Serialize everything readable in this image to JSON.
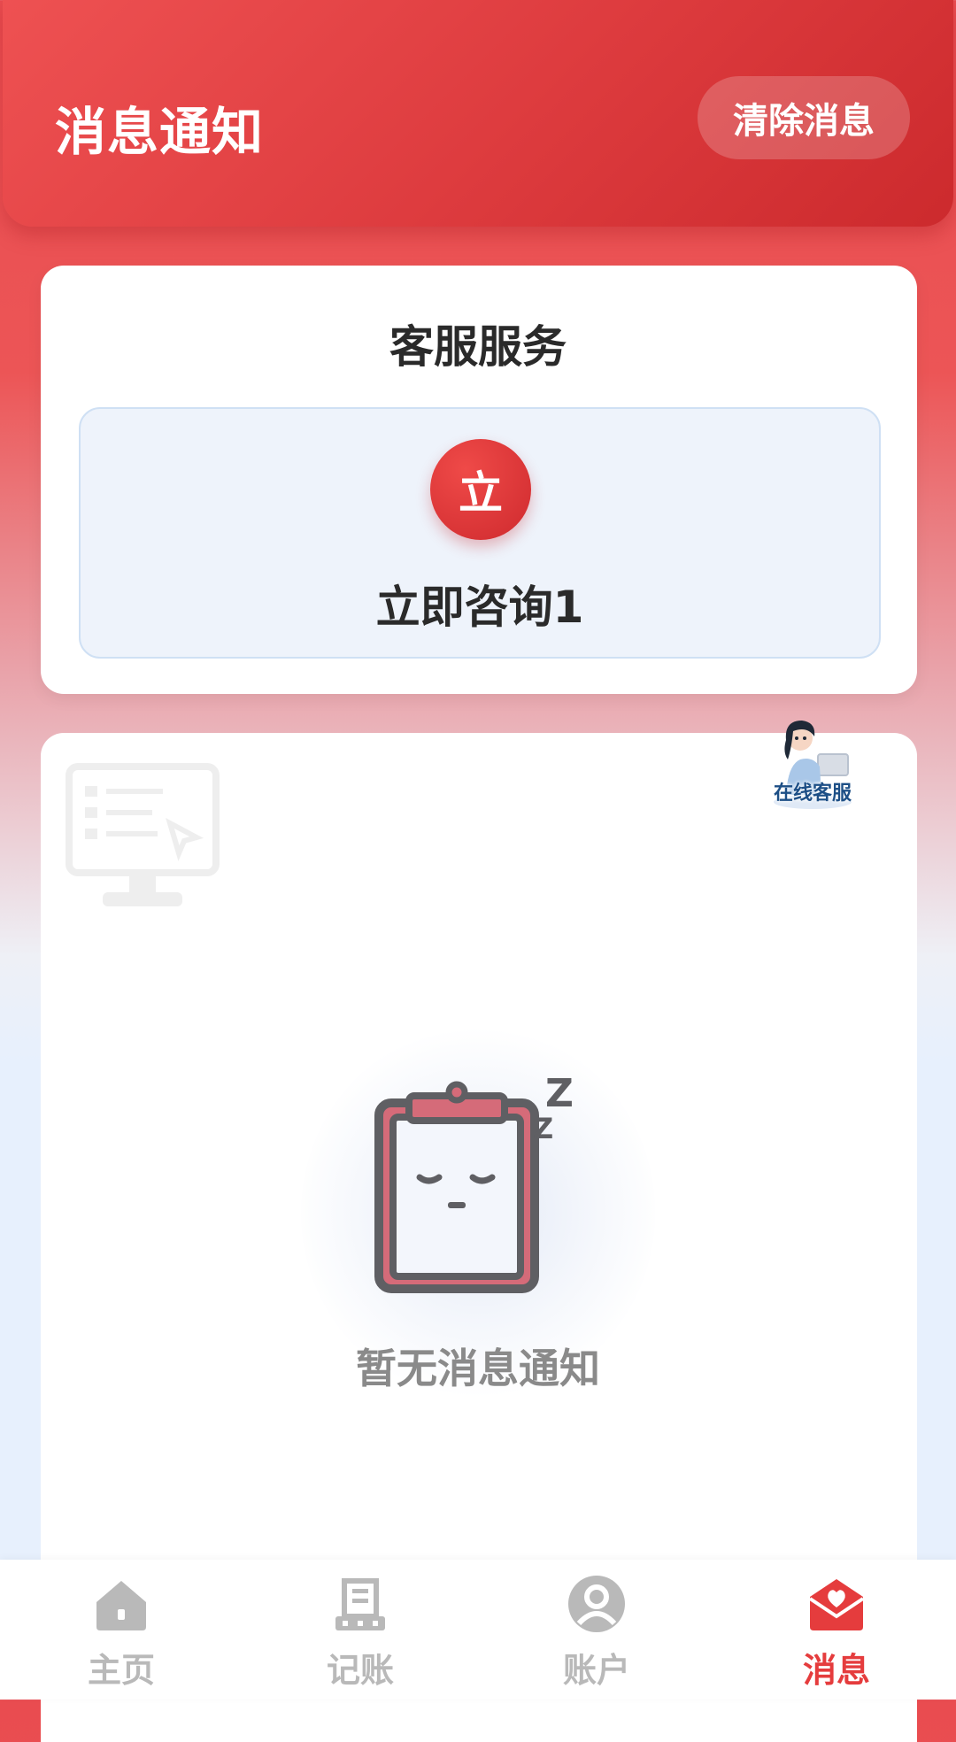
{
  "header": {
    "title": "消息通知",
    "clear_button": "清除消息"
  },
  "service": {
    "title": "客服服务",
    "consult_icon_text": "立",
    "consult_label": "立即咨询1"
  },
  "agent_badge": {
    "label": "在线客服",
    "icon": "customer-service-avatar"
  },
  "empty_state": {
    "text": "暂无消息通知",
    "icon": "sleeping-clipboard-icon"
  },
  "nav": {
    "items": [
      {
        "label": "主页",
        "icon": "home-icon",
        "active": false
      },
      {
        "label": "记账",
        "icon": "ledger-icon",
        "active": false
      },
      {
        "label": "账户",
        "icon": "user-icon",
        "active": false
      },
      {
        "label": "消息",
        "icon": "mail-heart-icon",
        "active": true
      }
    ]
  },
  "colors": {
    "accent": "#e53c3d",
    "header_gradient_start": "#ee5152",
    "header_gradient_end": "#cc2a2d",
    "inactive": "#b9b9b9"
  }
}
